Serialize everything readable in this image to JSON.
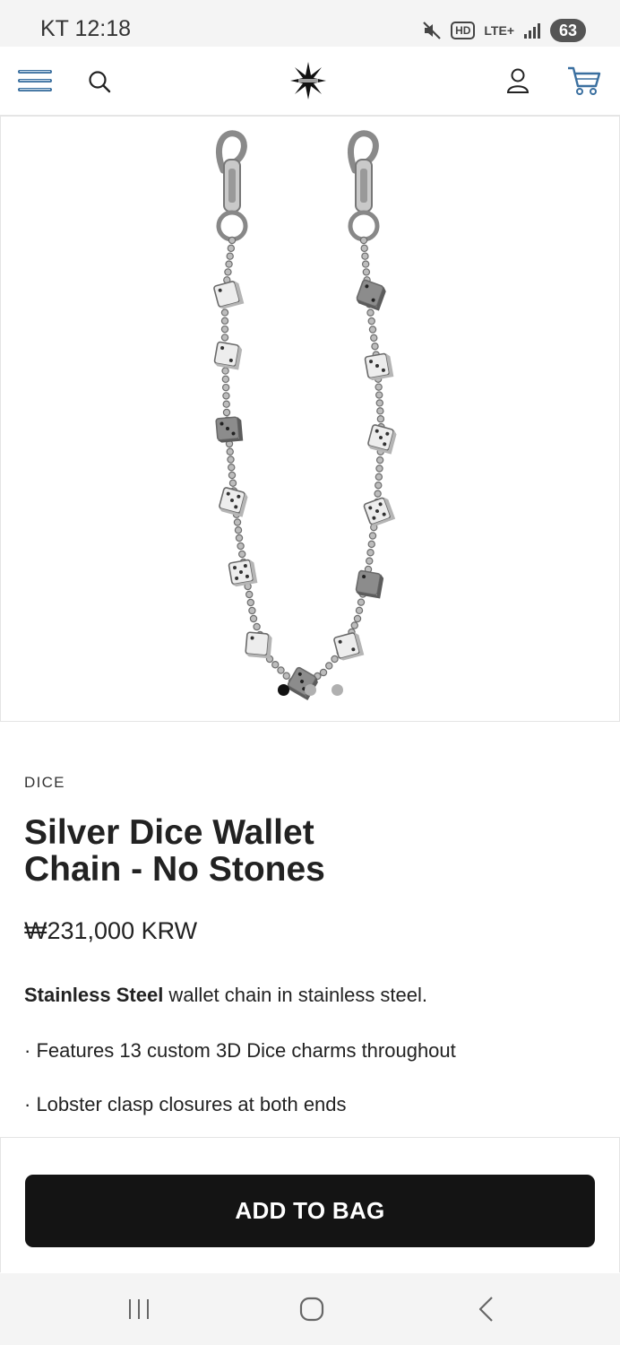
{
  "status_bar": {
    "time": "KT 12:18",
    "hd": "HD",
    "lte": "LTE+",
    "battery": "63",
    "icons": [
      "mute-icon",
      "signal-icon"
    ]
  },
  "header": {
    "icons": [
      "menu-icon",
      "search-icon",
      "brand-logo-star",
      "account-icon",
      "cart-icon"
    ]
  },
  "gallery": {
    "image_alt": "Silver dice wallet chain",
    "slide_count": 3,
    "active_slide": 1
  },
  "product": {
    "vendor": "DICE",
    "title_line1": "Silver Dice Wallet",
    "title_line2": "Chain - No Stones",
    "price": "₩231,000 KRW",
    "desc_bold": "Stainless Steel",
    "desc_rest": " wallet chain in stainless steel.",
    "feature_1": "· Features 13 custom 3D Dice charms throughout",
    "feature_2": "· Lobster clasp closures at both ends"
  },
  "buy": {
    "add_to_bag_label": "ADD TO BAG",
    "button_color": "#141414"
  },
  "navbar": {
    "icons": [
      "recent-apps-icon",
      "home-icon",
      "back-icon"
    ]
  }
}
